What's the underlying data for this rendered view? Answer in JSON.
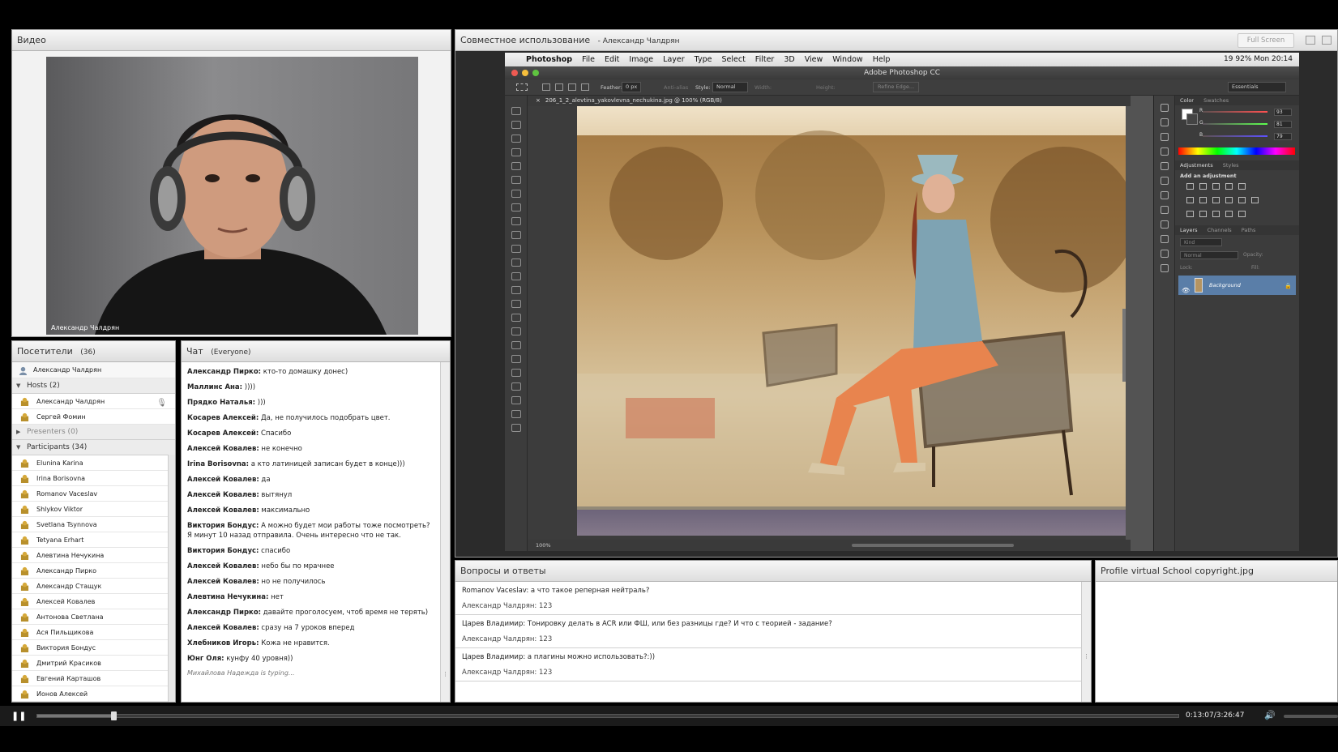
{
  "video": {
    "title": "Видео",
    "presenter_name": "Александр Чалдрян"
  },
  "attendees": {
    "title": "Посетители",
    "count": "(36)",
    "current_user": "Александр Чалдрян",
    "hosts_label": "Hosts (2)",
    "hosts": [
      "Александр Чалдрян",
      "Сергей Фомин"
    ],
    "presenters_label": "Presenters (0)",
    "participants_label": "Participants (34)",
    "participants": [
      "Elunina Karina",
      "Irina Borisovna",
      "Romanov Vaceslav",
      "Shlykov Viktor",
      "Svetlana Tsynnova",
      "Tetyana Erhart",
      "Алевтина Нечукина",
      "Александр Пирко",
      "Александр Стащук",
      "Алексей Ковалев",
      "Антонова Светлана",
      "Ася Пильщикова",
      "Виктория Бондус",
      "Дмитрий Красиков",
      "Евгений Карташов",
      "Ионов Алексей"
    ]
  },
  "chat": {
    "title": "Чат",
    "scope": "(Everyone)",
    "messages": [
      {
        "author": "Александр Пирко:",
        "text": " кто-то домашку донес)"
      },
      {
        "author": "Маллинс Ана:",
        "text": " ))))"
      },
      {
        "author": "Прядко Наталья:",
        "text": " )))"
      },
      {
        "author": "Косарев Алексей:",
        "text": " Да, не получилось подобрать цвет."
      },
      {
        "author": "Косарев Алексей:",
        "text": " Спасибо"
      },
      {
        "author": "Алексей Ковалев:",
        "text": " не конечно"
      },
      {
        "author": "Irina Borisovna:",
        "text": " а кто латиницей записан будет в конце)))"
      },
      {
        "author": "Алексей Ковалев:",
        "text": " да"
      },
      {
        "author": "Алексей Ковалев:",
        "text": " вытянул"
      },
      {
        "author": "Алексей Ковалев:",
        "text": " максимально"
      },
      {
        "author": "Виктория Бондус:",
        "text": " А можно будет мои работы тоже посмотреть? Я минут 10 назад отправила. Очень интересно что не так."
      },
      {
        "author": "Виктория Бондус:",
        "text": " спасибо"
      },
      {
        "author": "Алексей Ковалев:",
        "text": " небо бы по мрачнее"
      },
      {
        "author": "Алексей Ковалев:",
        "text": " но не получилось"
      },
      {
        "author": "Алевтина Нечукина:",
        "text": " нет"
      },
      {
        "author": "Александр Пирко:",
        "text": " давайте проголосуем, чтоб время не терять)"
      },
      {
        "author": "Алексей Ковалев:",
        "text": " сразу на 7 уроков вперед"
      },
      {
        "author": "Хлебников Игорь:",
        "text": " Кожа не нравится."
      },
      {
        "author": "Юнг Оля:",
        "text": " кунфу 40 уровня))"
      }
    ],
    "typing": "Михайлова Надежда is typing..."
  },
  "share": {
    "title": "Совместное использование",
    "subtitle": "- Александр Чалдрян",
    "fullscreen_label": "Full Screen",
    "photoshop": {
      "menu": [
        "Photoshop",
        "File",
        "Edit",
        "Image",
        "Layer",
        "Type",
        "Select",
        "Filter",
        "3D",
        "View",
        "Window",
        "Help"
      ],
      "status_right": "19   92%   Mon 20:14",
      "window_title": "Adobe Photoshop CC",
      "options": {
        "feather_label": "Feather:",
        "feather_value": "0 px",
        "antialias": "Anti-alias",
        "style_label": "Style:",
        "style_value": "Normal",
        "width_label": "Width:",
        "height_label": "Height:",
        "refine": "Refine Edge...",
        "workspace": "Essentials"
      },
      "doc_tab": "206_1_2_alevtina_yakovlevna_nechukina.jpg @ 100% (RGB/8)",
      "zoom": "100%",
      "panels": {
        "color_tabs": [
          "Color",
          "Swatches"
        ],
        "rgb": [
          {
            "label": "R",
            "value": "93"
          },
          {
            "label": "G",
            "value": "81"
          },
          {
            "label": "B",
            "value": "79"
          }
        ],
        "adjust_tabs": [
          "Adjustments",
          "Styles"
        ],
        "adjust_label": "Add an adjustment",
        "layer_tabs": [
          "Layers",
          "Channels",
          "Paths"
        ],
        "kind": "Kind",
        "blend": "Normal",
        "opacity": "Opacity:",
        "lock": "Lock:",
        "fill": "Fill:",
        "layer_name": "Background"
      }
    }
  },
  "qa": {
    "title": "Вопросы и ответы",
    "items": [
      {
        "question": "Romanov Vaceslav: а что такое реперная нейтраль?",
        "answer": "Александр Чалдрян: 123"
      },
      {
        "question": "Царев Владимир: Тонировку делать в ACR или ФШ, или без разницы где? И что с теорией - задание?",
        "answer": "Александр Чалдрян: 123"
      },
      {
        "question": "Царев Владимир: а плагины можно использовать?:))",
        "answer": "Александр Чалдрян: 123"
      }
    ]
  },
  "file_pod": {
    "title": "Profile virtual School copyright.jpg"
  },
  "player": {
    "time": "0:13:07/3:26:47",
    "progress": 0.067
  }
}
